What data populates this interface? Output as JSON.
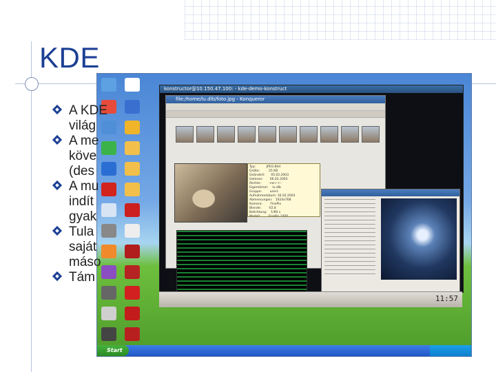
{
  "slide": {
    "title": "KDE",
    "bullets": [
      {
        "lines": [
          "A KDE",
          "világ"
        ]
      },
      {
        "lines": [
          "A me",
          "köve",
          "(des"
        ]
      },
      {
        "lines": [
          "A mu",
          "indít",
          "gyak"
        ]
      },
      {
        "lines": [
          "Tula",
          "saját",
          "máso"
        ]
      },
      {
        "lines": [
          "Tám"
        ]
      }
    ]
  },
  "screenshot": {
    "konqueror_title": "file:/home/lu.dlb/foto.jpg - Konqueror",
    "kde_title": "konstructor@10.150.47.100: - kde-demo-konstruct",
    "clock": "11:57",
    "start_label": "Start",
    "meta_text": "Typ:           JPEG-Bild\nGröße:         25 KB\nGeändert:      05.02.2003\nGelesen:       06.02.2003\nRechte:        -rw-r--r--\nEigentümer:    lu.dlb\nGruppe:        users\nAufnahmedatum: 16.02.2003\nAbmessungen:   1024x768\nKamera:        FinePix\nBlende:        f/2.8\nBelichtung:    1/60 s\nModell:        FinePix 1400"
  },
  "colors": {
    "title": "#1c3f94",
    "bullet_marker": "#1c3f94",
    "text": "#222222"
  },
  "icons": [
    "diamond-bullet-icon",
    "computer-icon",
    "lightbulb-icon"
  ]
}
